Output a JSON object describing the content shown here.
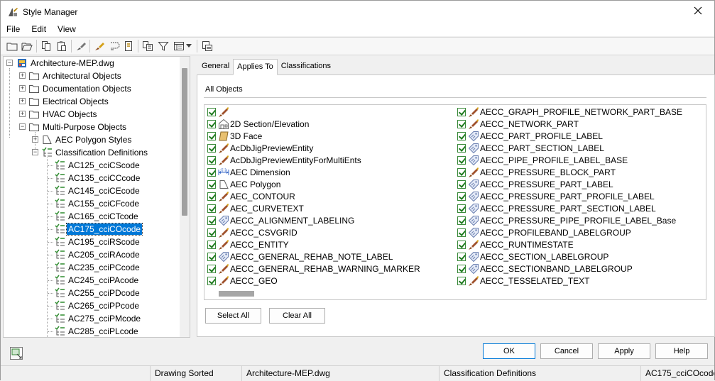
{
  "window": {
    "title": "Style Manager"
  },
  "menu": [
    "File",
    "Edit",
    "View"
  ],
  "toolbar_icons": [
    "new-drawing-icon",
    "open-drawing-icon",
    "copy-icon",
    "paste-icon",
    "edit-style-icon",
    "purge-icon",
    "toggle-view-icon",
    "set-from-icon",
    "inline-edit-icon",
    "sort-icon",
    "filter-icon",
    "view-options-icon",
    "chevron-down-icon",
    "style-browser-icon"
  ],
  "tree": {
    "root": "Architecture-MEP.dwg",
    "folders": [
      "Architectural Objects",
      "Documentation Objects",
      "Electrical Objects",
      "HVAC Objects",
      "Multi-Purpose Objects"
    ],
    "mp_children": [
      "AEC Polygon Styles",
      "Classification Definitions"
    ],
    "classifications": [
      "AC125_cciCScode",
      "AC135_cciCCcode",
      "AC145_cciCEcode",
      "AC155_cciCFcode",
      "AC165_cciCTcode",
      "AC175_cciCOcode",
      "AC195_cciRScode",
      "AC205_cciRAcode",
      "AC235_cciPCcode",
      "AC245_cciPAcode",
      "AC255_cciPDcode",
      "AC265_cciPPcode",
      "AC275_cciPMcode",
      "AC285_cciPLcode"
    ],
    "selected": "AC175_cciCOcode"
  },
  "tabs": [
    "General",
    "Applies To",
    "Classifications"
  ],
  "active_tab": "Applies To",
  "all_objects_label": "All Objects",
  "list_left": [
    {
      "label": "",
      "icon": "brush-icon"
    },
    {
      "label": "2D Section/Elevation",
      "icon": "section-icon"
    },
    {
      "label": "3D Face",
      "icon": "face-icon"
    },
    {
      "label": "AcDbJigPreviewEntity",
      "icon": "brush-icon"
    },
    {
      "label": "AcDbJigPreviewEntityForMultiEnts",
      "icon": "brush-icon"
    },
    {
      "label": "AEC Dimension",
      "icon": "dimension-icon"
    },
    {
      "label": "AEC Polygon",
      "icon": "polygon-icon"
    },
    {
      "label": "AEC_CONTOUR",
      "icon": "brush-icon"
    },
    {
      "label": "AEC_CURVETEXT",
      "icon": "brush-icon"
    },
    {
      "label": "AECC_ALIGNMENT_LABELING",
      "icon": "tag-icon"
    },
    {
      "label": "AECC_CSVGRID",
      "icon": "brush-icon"
    },
    {
      "label": "AECC_ENTITY",
      "icon": "brush-icon"
    },
    {
      "label": "AECC_GENERAL_REHAB_NOTE_LABEL",
      "icon": "tag-icon"
    },
    {
      "label": "AECC_GENERAL_REHAB_WARNING_MARKER",
      "icon": "brush-icon"
    },
    {
      "label": "AECC_GEO",
      "icon": "brush-icon"
    }
  ],
  "list_right": [
    {
      "label": "AECC_GRAPH_PROFILE_NETWORK_PART_BASE",
      "icon": "brush-icon"
    },
    {
      "label": "AECC_NETWORK_PART",
      "icon": "brush-icon"
    },
    {
      "label": "AECC_PART_PROFILE_LABEL",
      "icon": "tag-icon"
    },
    {
      "label": "AECC_PART_SECTION_LABEL",
      "icon": "tag-icon"
    },
    {
      "label": "AECC_PIPE_PROFILE_LABEL_BASE",
      "icon": "tag-icon"
    },
    {
      "label": "AECC_PRESSURE_BLOCK_PART",
      "icon": "brush-icon"
    },
    {
      "label": "AECC_PRESSURE_PART_LABEL",
      "icon": "tag-icon"
    },
    {
      "label": "AECC_PRESSURE_PART_PROFILE_LABEL",
      "icon": "tag-icon"
    },
    {
      "label": "AECC_PRESSURE_PART_SECTION_LABEL",
      "icon": "tag-icon"
    },
    {
      "label": "AECC_PRESSURE_PIPE_PROFILE_LABEL_Base",
      "icon": "tag-icon"
    },
    {
      "label": "AECC_PROFILEBAND_LABELGROUP",
      "icon": "tag-icon"
    },
    {
      "label": "AECC_RUNTIMESTATE",
      "icon": "brush-icon"
    },
    {
      "label": "AECC_SECTION_LABELGROUP",
      "icon": "tag-icon"
    },
    {
      "label": "AECC_SECTIONBAND_LABELGROUP",
      "icon": "tag-icon"
    },
    {
      "label": "AECC_TESSELATED_TEXT",
      "icon": "brush-icon"
    }
  ],
  "buttons": {
    "select_all": "Select All",
    "clear_all": "Clear All",
    "ok": "OK",
    "cancel": "Cancel",
    "apply": "Apply",
    "help": "Help"
  },
  "status": {
    "sort": "Drawing Sorted",
    "drawing": "Architecture-MEP.dwg",
    "category": "Classification Definitions",
    "style": "AC175_cciCOcode"
  },
  "colors": {
    "accent": "#0078d7",
    "check": "#1e7a1e",
    "brush": "#8b4a1c",
    "tag": "#6a7fb0"
  }
}
